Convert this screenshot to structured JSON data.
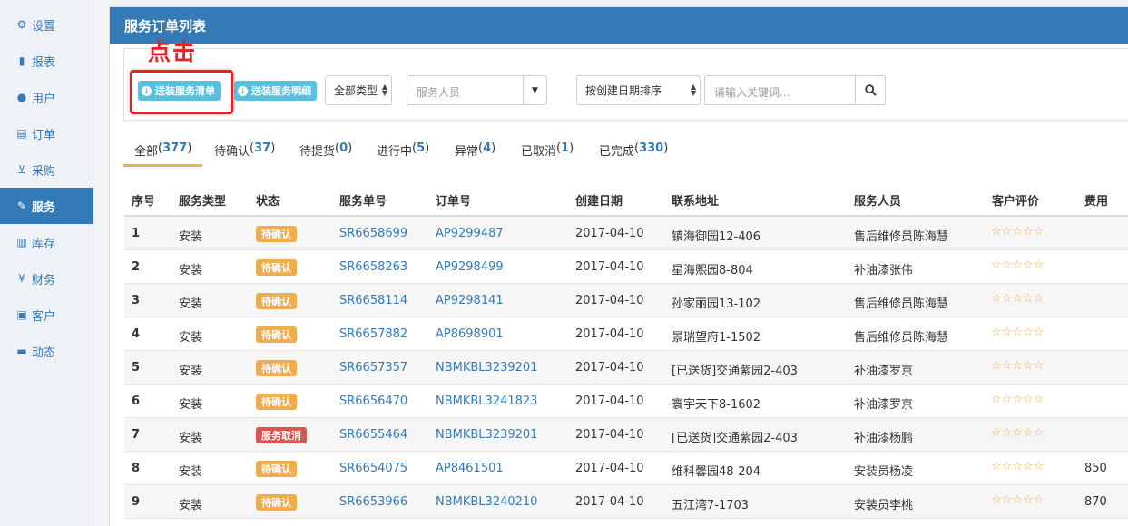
{
  "sidebar": {
    "items": [
      {
        "label": "设置",
        "icon": "gear-icon",
        "glyph": "⚙"
      },
      {
        "label": "报表",
        "icon": "bar-chart-icon",
        "glyph": "▮"
      },
      {
        "label": "用户",
        "icon": "user-icon",
        "glyph": "●"
      },
      {
        "label": "订单",
        "icon": "list-icon",
        "glyph": "▤"
      },
      {
        "label": "采购",
        "icon": "cart-icon",
        "glyph": "⊻"
      },
      {
        "label": "服务",
        "icon": "wrench-icon",
        "glyph": "✎"
      },
      {
        "label": "库存",
        "icon": "barcode-icon",
        "glyph": "▥"
      },
      {
        "label": "财务",
        "icon": "yen-icon",
        "glyph": "¥"
      },
      {
        "label": "客户",
        "icon": "briefcase-icon",
        "glyph": "▣"
      },
      {
        "label": "动态",
        "icon": "comment-icon",
        "glyph": "▬"
      }
    ],
    "active_index": 5,
    "accent": "#337ab7"
  },
  "panel": {
    "title": "服务订单列表"
  },
  "toolbar": {
    "btn_send_list": "送装服务清单",
    "btn_send_detail": "送装服务明细",
    "type_select": "全部类型",
    "staff_placeholder": "服务人员",
    "sort_select": "按创建日期排序",
    "search_placeholder": "请输入关键词..."
  },
  "annotation": {
    "text": "点击",
    "color": "#e52222"
  },
  "tabs": [
    {
      "label": "全部",
      "count": "377"
    },
    {
      "label": "待确认",
      "count": "37"
    },
    {
      "label": "待提货",
      "count": "0"
    },
    {
      "label": "进行中",
      "count": "5"
    },
    {
      "label": "异常",
      "count": "4"
    },
    {
      "label": "已取消",
      "count": "1"
    },
    {
      "label": "已完成",
      "count": "330"
    }
  ],
  "table": {
    "columns": [
      "序号",
      "服务类型",
      "状态",
      "服务单号",
      "订单号",
      "创建日期",
      "联系地址",
      "服务人员",
      "客户评价",
      "费用"
    ],
    "rows": [
      {
        "seq": "1",
        "type": "安装",
        "status": "待确认",
        "status_kind": "pending",
        "service_no": "SR6658699",
        "order_no": "AP9299487",
        "date": "2017-04-10",
        "address": "镇海御园12-406",
        "staff": "售后维修员陈海慧",
        "rating": "☆☆☆☆☆",
        "fee": ""
      },
      {
        "seq": "2",
        "type": "安装",
        "status": "待确认",
        "status_kind": "pending",
        "service_no": "SR6658263",
        "order_no": "AP9298499",
        "date": "2017-04-10",
        "address": "星海熙园8-804",
        "staff": "补油漆张伟",
        "rating": "☆☆☆☆☆",
        "fee": ""
      },
      {
        "seq": "3",
        "type": "安装",
        "status": "待确认",
        "status_kind": "pending",
        "service_no": "SR6658114",
        "order_no": "AP9298141",
        "date": "2017-04-10",
        "address": "孙家丽园13-102",
        "staff": "售后维修员陈海慧",
        "rating": "☆☆☆☆☆",
        "fee": ""
      },
      {
        "seq": "4",
        "type": "安装",
        "status": "待确认",
        "status_kind": "pending",
        "service_no": "SR6657882",
        "order_no": "AP8698901",
        "date": "2017-04-10",
        "address": "景瑞望府1-1502",
        "staff": "售后维修员陈海慧",
        "rating": "☆☆☆☆☆",
        "fee": ""
      },
      {
        "seq": "5",
        "type": "安装",
        "status": "待确认",
        "status_kind": "pending",
        "service_no": "SR6657357",
        "order_no": "NBMKBL3239201",
        "date": "2017-04-10",
        "address": "[已送货]交通紫园2-403",
        "staff": "补油漆罗京",
        "rating": "☆☆☆☆☆",
        "fee": ""
      },
      {
        "seq": "6",
        "type": "安装",
        "status": "待确认",
        "status_kind": "pending",
        "service_no": "SR6656470",
        "order_no": "NBMKBL3241823",
        "date": "2017-04-10",
        "address": "寰宇天下8-1602",
        "staff": "补油漆罗京",
        "rating": "☆☆☆☆☆",
        "fee": ""
      },
      {
        "seq": "7",
        "type": "安装",
        "status": "服务取消",
        "status_kind": "cancel",
        "service_no": "SR6655464",
        "order_no": "NBMKBL3239201",
        "date": "2017-04-10",
        "address": "[已送货]交通紫园2-403",
        "staff": "补油漆杨鹏",
        "rating": "☆☆☆☆☆",
        "fee": ""
      },
      {
        "seq": "8",
        "type": "安装",
        "status": "待确认",
        "status_kind": "pending",
        "service_no": "SR6654075",
        "order_no": "AP8461501",
        "date": "2017-04-10",
        "address": "维科馨园48-204",
        "staff": "安装员杨凌",
        "rating": "☆☆☆☆☆",
        "fee": "850"
      },
      {
        "seq": "9",
        "type": "安装",
        "status": "待确认",
        "status_kind": "pending",
        "service_no": "SR6653966",
        "order_no": "NBMKBL3240210",
        "date": "2017-04-10",
        "address": "五江湾7-1703",
        "staff": "安装员李桃",
        "rating": "☆☆☆☆☆",
        "fee": "870"
      }
    ]
  }
}
